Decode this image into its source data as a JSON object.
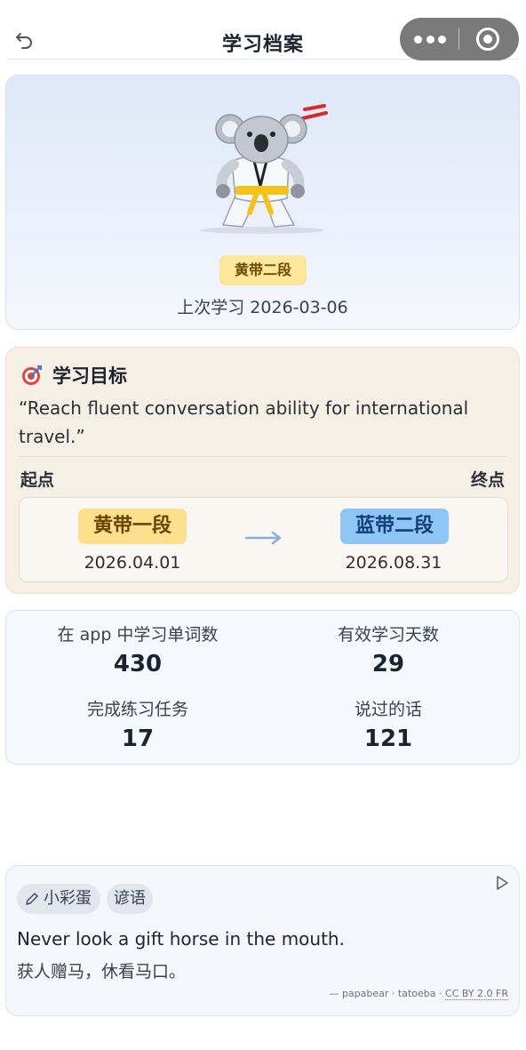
{
  "header": {
    "title": "学习档案"
  },
  "profile": {
    "rank_badge": "黄带二段",
    "last_study": "上次学习 2026-03-06"
  },
  "goal": {
    "heading": "学习目标",
    "quote": "“Reach fluent conversation ability for international travel.”",
    "start_label": "起点",
    "end_label": "终点",
    "from_belt": "黄带一段",
    "from_date": "2026.04.01",
    "to_belt": "蓝带二段",
    "to_date": "2026.08.31"
  },
  "stats": [
    {
      "label": "在 app 中学习单词数",
      "value": "430"
    },
    {
      "label": "有效学习天数",
      "value": "29"
    },
    {
      "label": "完成练习任务",
      "value": "17"
    },
    {
      "label": "说过的话",
      "value": "121"
    }
  ],
  "egg": {
    "chip_easter": "小彩蛋",
    "chip_proverb": "谚语",
    "proverb_en": "Never look a gift horse in the mouth.",
    "proverb_zh": "获人赠马，休看马口。",
    "credit_prefix": "— papabear · tatoeba ·",
    "credit_license": "CC BY 2.0 FR"
  },
  "colors": {
    "yellow_belt": "#fde08d",
    "blue_belt": "#8ec5f5",
    "capsule": "#7a7a7a"
  },
  "icons": [
    "back-icon",
    "more-icon",
    "close-target-icon",
    "target-icon",
    "arrow-right-icon",
    "pencil-icon",
    "play-icon"
  ]
}
